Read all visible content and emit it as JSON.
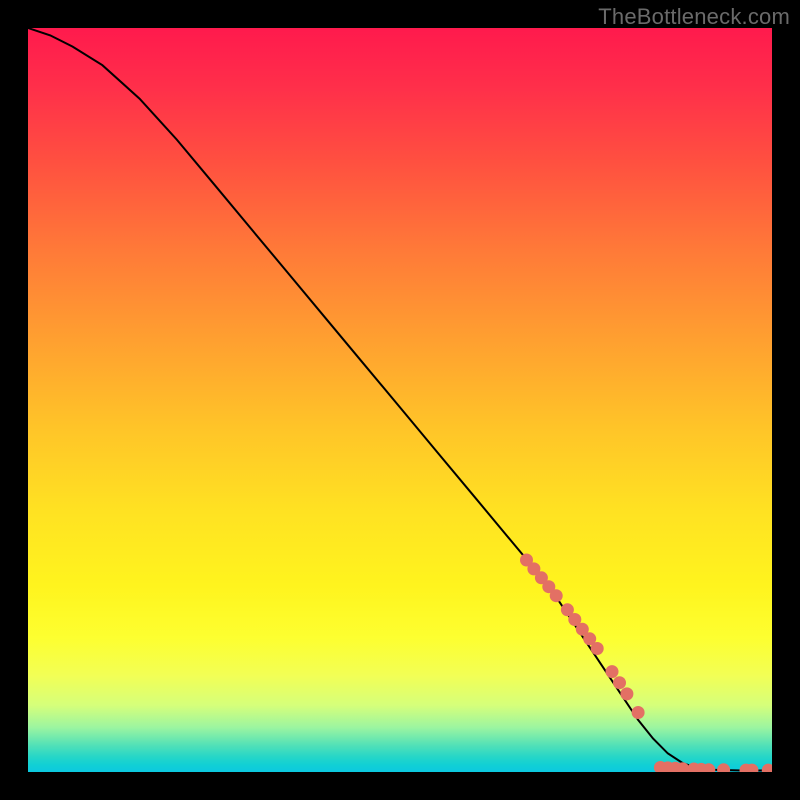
{
  "attribution": "TheBottleneck.com",
  "colors": {
    "line": "#000000",
    "marker": "#e37064",
    "frame": "#000000"
  },
  "chart_data": {
    "type": "line",
    "title": "",
    "xlabel": "",
    "ylabel": "",
    "xlim": [
      0,
      100
    ],
    "ylim": [
      0,
      100
    ],
    "grid": false,
    "series": [
      {
        "name": "curve",
        "x": [
          0,
          3,
          6,
          10,
          15,
          20,
          25,
          30,
          35,
          40,
          45,
          50,
          55,
          60,
          65,
          70,
          74,
          77,
          80,
          82,
          84,
          86,
          88,
          90,
          92,
          94,
          96,
          98,
          100
        ],
        "y": [
          100,
          99,
          97.5,
          95,
          90.5,
          85,
          79,
          73,
          67,
          61,
          55,
          49,
          43,
          37,
          31,
          25,
          19,
          14.5,
          10,
          7,
          4.5,
          2.5,
          1.2,
          0.5,
          0.3,
          0.25,
          0.2,
          0.2,
          0.2
        ]
      }
    ],
    "marker_clusters": [
      {
        "name": "diagonal-cluster",
        "points": [
          {
            "x": 67,
            "y": 28.5
          },
          {
            "x": 68,
            "y": 27.3
          },
          {
            "x": 69,
            "y": 26.1
          },
          {
            "x": 70,
            "y": 24.9
          },
          {
            "x": 71,
            "y": 23.7
          },
          {
            "x": 72.5,
            "y": 21.8
          },
          {
            "x": 73.5,
            "y": 20.5
          },
          {
            "x": 74.5,
            "y": 19.2
          },
          {
            "x": 75.5,
            "y": 17.9
          },
          {
            "x": 76.5,
            "y": 16.6
          },
          {
            "x": 78.5,
            "y": 13.5
          },
          {
            "x": 79.5,
            "y": 12.0
          },
          {
            "x": 80.5,
            "y": 10.5
          },
          {
            "x": 82,
            "y": 8.0
          }
        ]
      },
      {
        "name": "bottom-cluster",
        "points": [
          {
            "x": 85,
            "y": 0.6
          },
          {
            "x": 86,
            "y": 0.55
          },
          {
            "x": 87,
            "y": 0.5
          },
          {
            "x": 88,
            "y": 0.45
          },
          {
            "x": 89.5,
            "y": 0.4
          },
          {
            "x": 90.5,
            "y": 0.35
          },
          {
            "x": 91.5,
            "y": 0.3
          },
          {
            "x": 93.5,
            "y": 0.3
          },
          {
            "x": 96.5,
            "y": 0.25
          },
          {
            "x": 97.3,
            "y": 0.25
          },
          {
            "x": 99.5,
            "y": 0.25
          }
        ]
      }
    ]
  }
}
